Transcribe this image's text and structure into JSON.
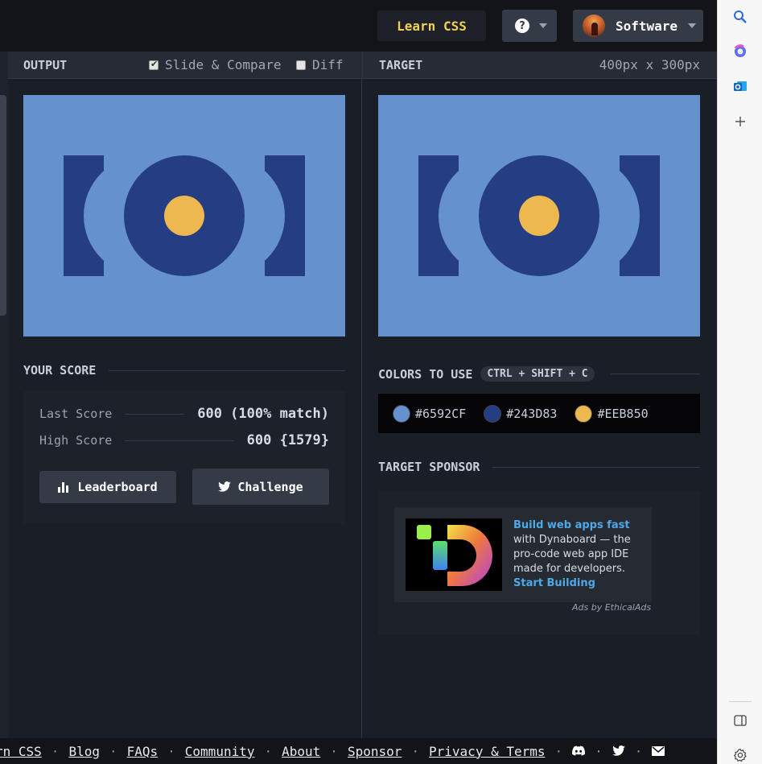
{
  "topbar": {
    "learn_css": "Learn CSS",
    "help_icon": "?",
    "user_name": "Software"
  },
  "output_panel": {
    "title": "OUTPUT",
    "slide_compare": "Slide & Compare",
    "slide_compare_checked": true,
    "diff": "Diff",
    "diff_checked": false
  },
  "target_panel": {
    "title": "TARGET",
    "dimensions": "400px x 300px"
  },
  "score": {
    "title": "YOUR SCORE",
    "last_label": "Last Score",
    "last_value": "600 (100% match)",
    "high_label": "High Score",
    "high_value": "600 {1579}",
    "leaderboard": "Leaderboard",
    "challenge": "Challenge"
  },
  "colors": {
    "title": "COLORS TO USE",
    "shortcut": "CTRL + SHIFT + C",
    "list": [
      {
        "hex": "#6592CF"
      },
      {
        "hex": "#243D83"
      },
      {
        "hex": "#EEB850"
      }
    ]
  },
  "sponsor": {
    "title": "TARGET SPONSOR",
    "headline": "Build web apps fast",
    "body": "with Dynaboard — the pro-code web app IDE made for developers.",
    "cta": "Start Building",
    "by": "Ads by EthicalAds"
  },
  "footer": {
    "links": [
      "rn CSS",
      "Blog",
      "FAQs",
      "Community",
      "About",
      "Sponsor",
      "Privacy & Terms"
    ],
    "icons": [
      "discord-icon",
      "twitter-icon",
      "mail-icon"
    ]
  },
  "sidebar": {
    "icons": [
      "search-icon",
      "copilot-icon",
      "outlook-icon",
      "add-icon",
      "panel-icon",
      "settings-icon"
    ]
  }
}
